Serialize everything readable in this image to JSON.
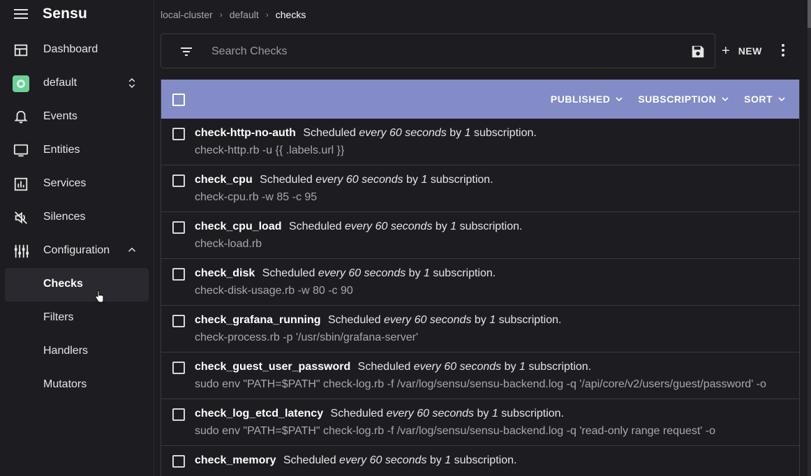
{
  "app": {
    "name": "Sensu"
  },
  "sidebar": {
    "items": [
      {
        "label": "Dashboard"
      },
      {
        "label": "default"
      },
      {
        "label": "Events"
      },
      {
        "label": "Entities"
      },
      {
        "label": "Services"
      },
      {
        "label": "Silences"
      },
      {
        "label": "Configuration"
      }
    ],
    "config_items": [
      {
        "label": "Checks",
        "active": true
      },
      {
        "label": "Filters"
      },
      {
        "label": "Handlers"
      },
      {
        "label": "Mutators"
      }
    ]
  },
  "breadcrumb": {
    "cluster": "local-cluster",
    "namespace": "default",
    "current": "checks"
  },
  "search": {
    "placeholder": "Search Checks",
    "value": ""
  },
  "toolbar": {
    "new_label": "NEW"
  },
  "list_header": {
    "published": "PUBLISHED",
    "subscription": "SUBSCRIPTION",
    "sort": "SORT"
  },
  "colors": {
    "header_bar": "#838cc7",
    "background": "#1d1c21",
    "namespace_badge": "#6fcf97"
  },
  "checks": [
    {
      "name": "check-http-no-auth",
      "prefix": "Scheduled",
      "interval": "every 60 seconds",
      "by": "by",
      "count": "1",
      "suffix": "subscription.",
      "command": "check-http.rb -u {{ .labels.url }}"
    },
    {
      "name": "check_cpu",
      "prefix": "Scheduled",
      "interval": "every 60 seconds",
      "by": "by",
      "count": "1",
      "suffix": "subscription.",
      "command": "check-cpu.rb -w 85 -c 95"
    },
    {
      "name": "check_cpu_load",
      "prefix": "Scheduled",
      "interval": "every 60 seconds",
      "by": "by",
      "count": "1",
      "suffix": "subscription.",
      "command": "check-load.rb"
    },
    {
      "name": "check_disk",
      "prefix": "Scheduled",
      "interval": "every 60 seconds",
      "by": "by",
      "count": "1",
      "suffix": "subscription.",
      "command": "check-disk-usage.rb -w 80 -c 90"
    },
    {
      "name": "check_grafana_running",
      "prefix": "Scheduled",
      "interval": "every 60 seconds",
      "by": "by",
      "count": "1",
      "suffix": "subscription.",
      "command": "check-process.rb -p '/usr/sbin/grafana-server'"
    },
    {
      "name": "check_guest_user_password",
      "prefix": "Scheduled",
      "interval": "every 60 seconds",
      "by": "by",
      "count": "1",
      "suffix": "subscription.",
      "command": "sudo env \"PATH=$PATH\" check-log.rb -f /var/log/sensu/sensu-backend.log -q '/api/core/v2/users/guest/password' -o"
    },
    {
      "name": "check_log_etcd_latency",
      "prefix": "Scheduled",
      "interval": "every 60 seconds",
      "by": "by",
      "count": "1",
      "suffix": "subscription.",
      "command": "sudo env \"PATH=$PATH\" check-log.rb -f /var/log/sensu/sensu-backend.log -q 'read-only range request' -o"
    },
    {
      "name": "check_memory",
      "prefix": "Scheduled",
      "interval": "every 60 seconds",
      "by": "by",
      "count": "1",
      "suffix": "subscription.",
      "command": ""
    }
  ]
}
